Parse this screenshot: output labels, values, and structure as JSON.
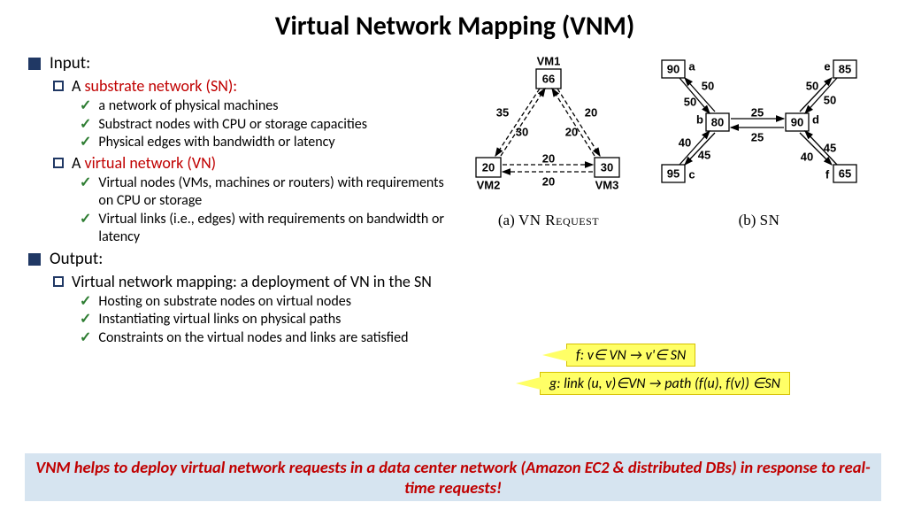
{
  "title": "Virtual Network Mapping (VNM)",
  "sections": {
    "input": {
      "label": "Input:",
      "sn": {
        "prefix": "A ",
        "label": "substrate network (SN):",
        "items": [
          "a network of physical machines",
          "Substract nodes with CPU or storage capacities",
          "Physical edges with  bandwidth or latency"
        ]
      },
      "vn": {
        "prefix": "A ",
        "label": "virtual network (VN)",
        "items": [
          "Virtual nodes  (VMs, machines or routers) with requirements on CPU or storage",
          "Virtual links (i.e., edges) with requirements on bandwidth or latency"
        ]
      }
    },
    "output": {
      "label": "Output:",
      "mapping": {
        "label": "Virtual network mapping: a deployment of VN in the SN",
        "items": [
          "Hosting on substrate nodes on virtual nodes",
          "Instantiating virtual links on physical paths",
          "Constraints on the virtual nodes and links are satisfied"
        ]
      }
    }
  },
  "callouts": {
    "f": "f: v∈ VN →  v'∈ SN",
    "g": "g: link (u, v)∈VN → path (f(u), f(v)) ∈SN"
  },
  "footer": "VNM helps to deploy virtual network requests in a data center network (Amazon EC2 & distributed DBs) in response to real-time requests!",
  "diagrams": {
    "a": {
      "caption_prefix": "(a) ",
      "caption": "VN Request",
      "nodes": [
        {
          "id": "VM1",
          "value": "66"
        },
        {
          "id": "VM2",
          "value": "20"
        },
        {
          "id": "VM3",
          "value": "30"
        }
      ],
      "edges": [
        {
          "from": "VM1",
          "to": "VM2",
          "labels": [
            "35",
            "30"
          ]
        },
        {
          "from": "VM1",
          "to": "VM3",
          "labels": [
            "20",
            "20"
          ]
        },
        {
          "from": "VM2",
          "to": "VM3",
          "labels": [
            "20",
            "20"
          ]
        }
      ]
    },
    "b": {
      "caption_prefix": "(b) ",
      "caption": "SN",
      "nodes": [
        {
          "id": "a",
          "value": "90"
        },
        {
          "id": "b",
          "value": "80"
        },
        {
          "id": "c",
          "value": "95"
        },
        {
          "id": "d",
          "value": "90"
        },
        {
          "id": "e",
          "value": "85"
        },
        {
          "id": "f",
          "value": "65"
        }
      ],
      "edges": [
        {
          "from": "a",
          "to": "b",
          "labels": [
            "50",
            "50"
          ]
        },
        {
          "from": "c",
          "to": "b",
          "labels": [
            "40",
            "45"
          ]
        },
        {
          "from": "b",
          "to": "d",
          "labels": [
            "25",
            "25"
          ]
        },
        {
          "from": "e",
          "to": "d",
          "labels": [
            "50",
            "50"
          ]
        },
        {
          "from": "f",
          "to": "d",
          "labels": [
            "40",
            "45"
          ]
        }
      ]
    }
  }
}
